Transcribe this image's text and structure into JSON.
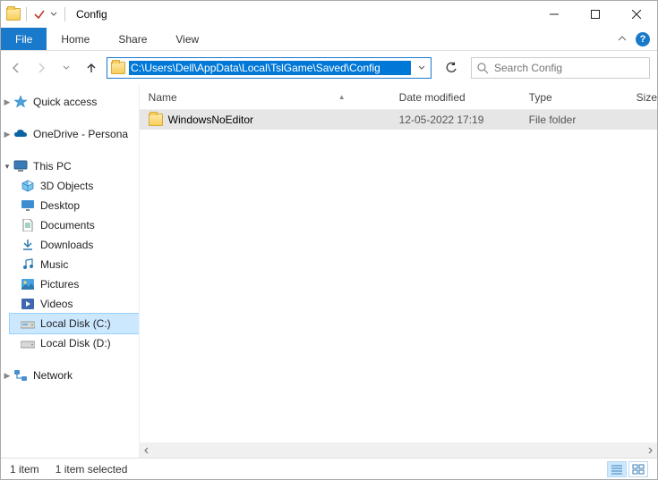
{
  "window": {
    "title": "Config"
  },
  "ribbon": {
    "file": "File",
    "tabs": [
      "Home",
      "Share",
      "View"
    ]
  },
  "address": {
    "path": "C:\\Users\\Dell\\AppData\\Local\\TslGame\\Saved\\Config"
  },
  "search": {
    "placeholder": "Search Config"
  },
  "sidebar": {
    "quick_access": "Quick access",
    "onedrive": "OneDrive - Persona",
    "this_pc": "This PC",
    "items": [
      {
        "label": "3D Objects"
      },
      {
        "label": "Desktop"
      },
      {
        "label": "Documents"
      },
      {
        "label": "Downloads"
      },
      {
        "label": "Music"
      },
      {
        "label": "Pictures"
      },
      {
        "label": "Videos"
      },
      {
        "label": "Local Disk (C:)"
      },
      {
        "label": "Local Disk (D:)"
      }
    ],
    "network": "Network"
  },
  "columns": {
    "name": "Name",
    "date": "Date modified",
    "type": "Type",
    "size": "Size"
  },
  "rows": [
    {
      "name": "WindowsNoEditor",
      "date": "12-05-2022 17:19",
      "type": "File folder",
      "size": ""
    }
  ],
  "status": {
    "count": "1 item",
    "selected": "1 item selected"
  }
}
